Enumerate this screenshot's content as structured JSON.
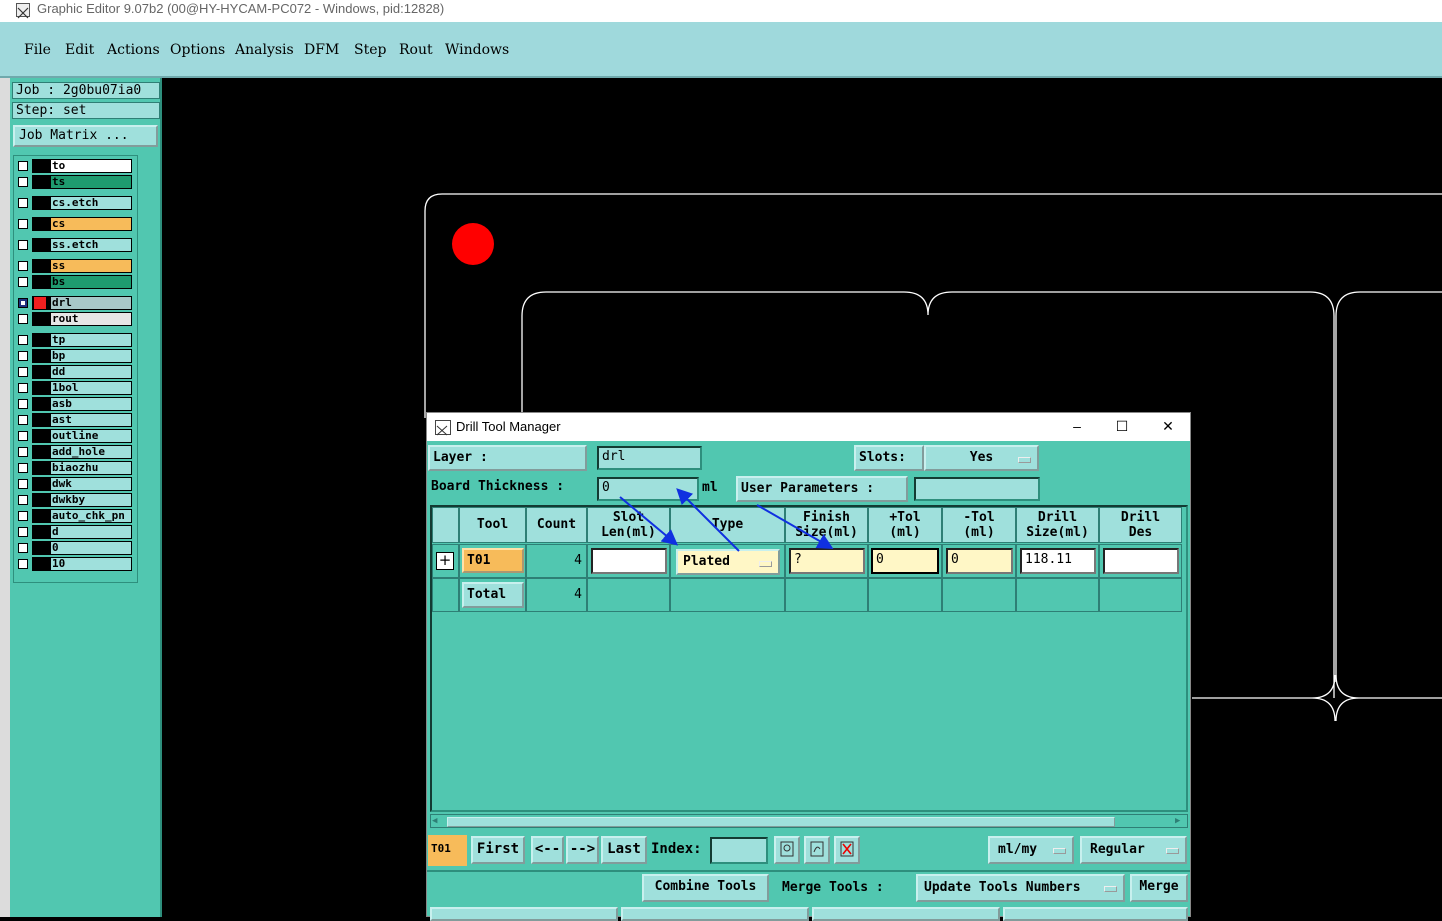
{
  "window": {
    "title": "Graphic Editor 9.07b2 (00@HY-HYCAM-PC072 - Windows, pid:12828)"
  },
  "menu": [
    "File",
    "Edit",
    "Actions",
    "Options",
    "Analysis",
    "DFM",
    "Step",
    "Rout",
    "Windows"
  ],
  "job": {
    "job_label": "Job : 2g0bu07ia0",
    "step_label": "Step: set",
    "matrix_button": "Job Matrix ..."
  },
  "layers": [
    {
      "name": "to",
      "color": "#ffffff"
    },
    {
      "name": "ts",
      "color": "#1e9b6f"
    },
    {
      "name": "cs.etch",
      "color": "#9fe0dc"
    },
    {
      "name": "cs",
      "color": "#f7bb5a"
    },
    {
      "name": "ss.etch",
      "color": "#9fe0dc"
    },
    {
      "name": "ss",
      "color": "#f7bb5a"
    },
    {
      "name": "bs",
      "color": "#1e9b6f"
    },
    {
      "name": "drl",
      "color": "#a8c8c8"
    },
    {
      "name": "rout",
      "color": "#e6e6e6"
    },
    {
      "name": "tp",
      "color": "#9fe0dc"
    },
    {
      "name": "bp",
      "color": "#9fe0dc"
    },
    {
      "name": "dd",
      "color": "#9fe0dc"
    },
    {
      "name": "1bol",
      "color": "#9fe0dc"
    },
    {
      "name": "asb",
      "color": "#9fe0dc"
    },
    {
      "name": "ast",
      "color": "#9fe0dc"
    },
    {
      "name": "outline",
      "color": "#9fe0dc"
    },
    {
      "name": "add_hole",
      "color": "#9fe0dc"
    },
    {
      "name": "biaozhu",
      "color": "#9fe0dc"
    },
    {
      "name": "dwk",
      "color": "#9fe0dc"
    },
    {
      "name": "dwkby",
      "color": "#9fe0dc"
    },
    {
      "name": "auto_chk_pn",
      "color": "#9fe0dc"
    },
    {
      "name": "d",
      "color": "#9fe0dc"
    },
    {
      "name": "0",
      "color": "#9fe0dc"
    },
    {
      "name": "10",
      "color": "#9fe0dc"
    }
  ],
  "dialog": {
    "title": "Drill Tool Manager",
    "layer_label": "Layer :",
    "layer_value": "drl",
    "slots_label": "Slots:",
    "slots_value": "Yes",
    "thickness_label": "Board Thickness :",
    "thickness_value": "0",
    "thickness_unit": "ml",
    "user_params_label": "User Parameters :",
    "user_params_value": "",
    "columns": {
      "tool": "Tool",
      "count": "Count",
      "slot_len_1": "Slot",
      "slot_len_2": "Len(ml)",
      "type": "Type",
      "finish_1": "Finish",
      "finish_2": "Size(ml)",
      "ptol_1": "+Tol",
      "ptol_2": "(ml)",
      "ntol_1": "-Tol",
      "ntol_2": "(ml)",
      "drill_1": "Drill",
      "drill_2": "Size(ml)",
      "des_1": "Drill",
      "des_2": "Des"
    },
    "row": {
      "tool": "T01",
      "count": "4",
      "slot_len": "",
      "type": "Plated",
      "finish": "?",
      "ptol": "0",
      "ntol": "0",
      "drill_size": "118.11",
      "drill_des": ""
    },
    "total": {
      "label": "Total",
      "count": "4"
    },
    "nav": {
      "current": "T01",
      "first": "First",
      "prev": "<--",
      "next": "-->",
      "last": "Last",
      "index_label": "Index:",
      "index_value": "",
      "units": "ml/my",
      "mode": "Regular"
    },
    "actions": {
      "combine": "Combine Tools",
      "merge_label": "Merge Tools :",
      "update": "Update Tools Numbers",
      "merge": "Merge"
    }
  }
}
